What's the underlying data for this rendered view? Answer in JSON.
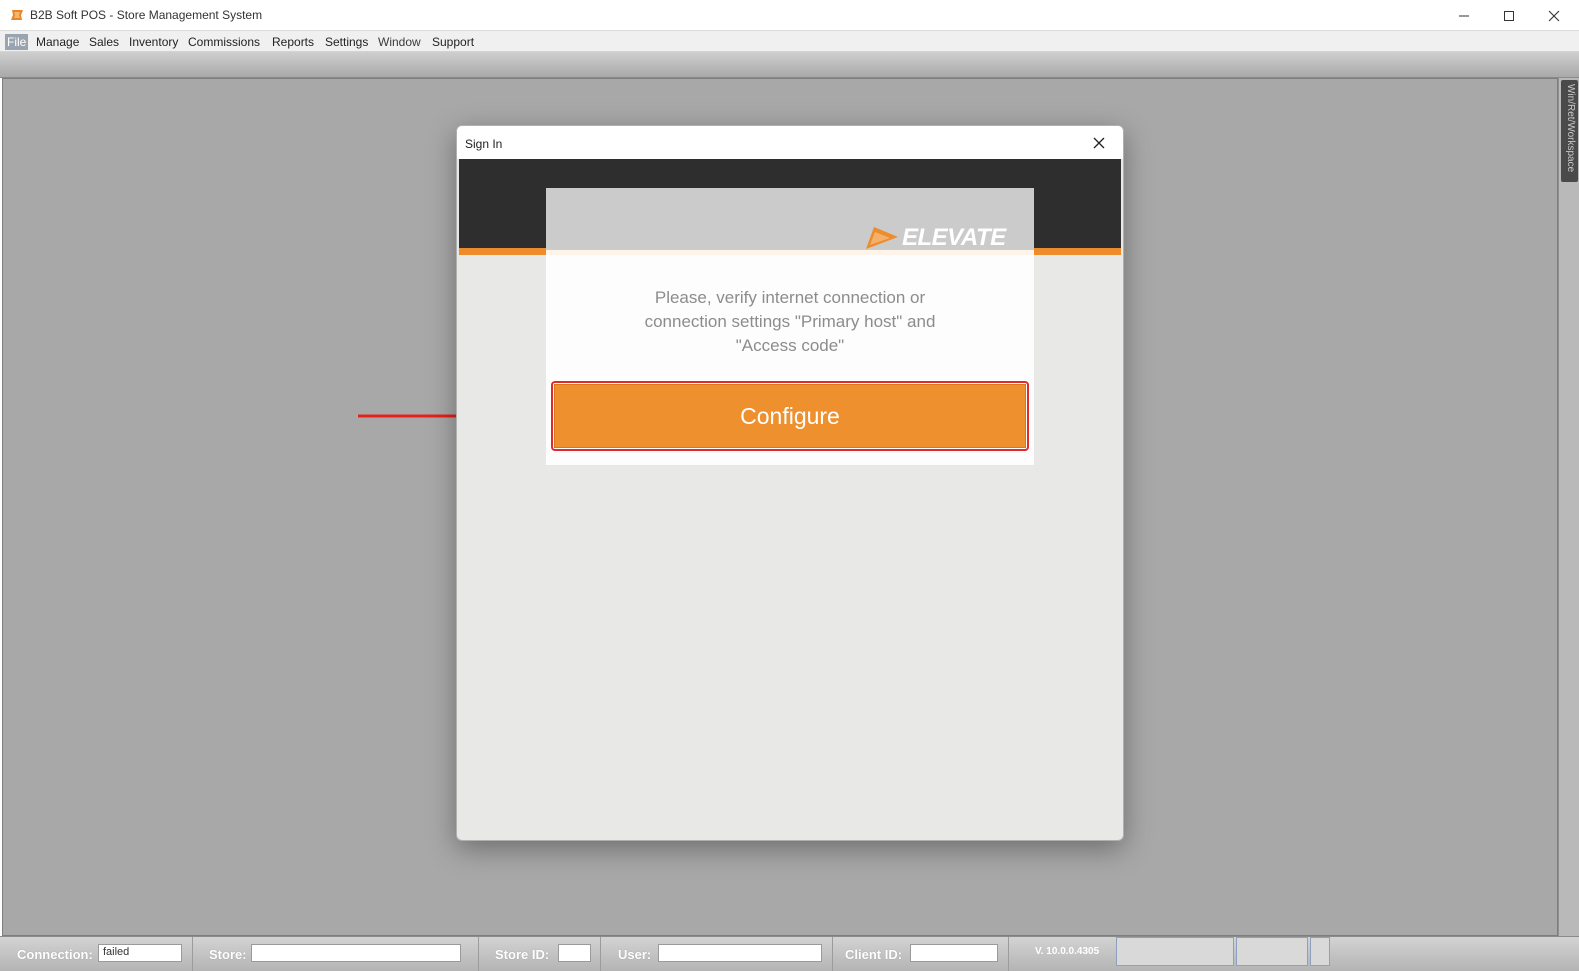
{
  "window": {
    "title": "B2B Soft POS - Store Management System"
  },
  "menu": {
    "items": [
      "File",
      "Manage",
      "Sales",
      "Inventory",
      "Commissions",
      "Reports",
      "Settings",
      "Window",
      "Support"
    ]
  },
  "side_panel": {
    "tab_label": "Win/Ret/Workspace"
  },
  "dialog": {
    "title": "Sign In",
    "logo_text": "ELEVATE",
    "message": "Please, verify internet connection or connection settings \"Primary host\" and \"Access code\"",
    "configure_label": "Configure"
  },
  "status": {
    "connection_label": "Connection:",
    "connection_value": "failed",
    "store_label": "Store:",
    "store_value": "",
    "store_id_label": "Store ID:",
    "store_id_value": "",
    "user_label": "User:",
    "user_value": "",
    "client_id_label": "Client ID:",
    "client_id_value": "",
    "version": "V. 10.0.0.4305"
  },
  "colors": {
    "accent_orange": "#ef902f",
    "banner_dark": "#2e2e2e",
    "highlight_red": "#e02b2b",
    "workspace_gray": "#a8a8a8"
  },
  "icons": {
    "app": "b2b-logo-icon",
    "minimize": "minimize-icon",
    "maximize": "maximize-icon",
    "close": "close-icon",
    "dialog_close": "close-icon",
    "logo_mark": "elevate-logo-icon",
    "annotation": "red-arrow-icon"
  }
}
